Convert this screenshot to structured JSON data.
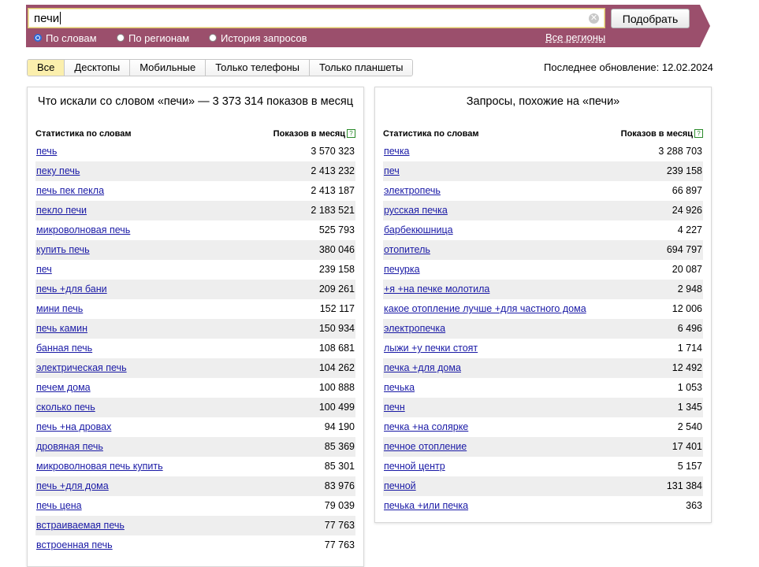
{
  "search": {
    "query": "печи",
    "submit_label": "Подобрать",
    "modes": [
      {
        "label": "По словам",
        "checked": true
      },
      {
        "label": "По регионам",
        "checked": false
      },
      {
        "label": "История запросов",
        "checked": false
      }
    ],
    "regions_link": "Все регионы"
  },
  "device_tabs": [
    {
      "label": "Все",
      "active": true
    },
    {
      "label": "Десктопы",
      "active": false
    },
    {
      "label": "Мобильные",
      "active": false
    },
    {
      "label": "Только телефоны",
      "active": false
    },
    {
      "label": "Только планшеты",
      "active": false
    }
  ],
  "last_update": "Последнее обновление: 12.02.2024",
  "left_panel": {
    "title": "Что искали со словом «печи» — 3 373 314 показов в месяц",
    "col_phrase": "Статистика по словам",
    "col_count": "Показов в месяц",
    "rows": [
      {
        "phrase": "печь",
        "count": "3 570 323"
      },
      {
        "phrase": "пеку печь",
        "count": "2 413 232"
      },
      {
        "phrase": "печь пек пекла",
        "count": "2 413 187"
      },
      {
        "phrase": "пекло печи",
        "count": "2 183 521"
      },
      {
        "phrase": "микроволновая печь",
        "count": "525 793"
      },
      {
        "phrase": "купить печь",
        "count": "380 046"
      },
      {
        "phrase": "печ",
        "count": "239 158"
      },
      {
        "phrase": "печь +для бани",
        "count": "209 261"
      },
      {
        "phrase": "мини печь",
        "count": "152 117"
      },
      {
        "phrase": "печь камин",
        "count": "150 934"
      },
      {
        "phrase": "банная печь",
        "count": "108 681"
      },
      {
        "phrase": "электрическая печь",
        "count": "104 262"
      },
      {
        "phrase": "печем дома",
        "count": "100 888"
      },
      {
        "phrase": "сколько печь",
        "count": "100 499"
      },
      {
        "phrase": "печь +на дровах",
        "count": "94 190"
      },
      {
        "phrase": "дровяная печь",
        "count": "85 369"
      },
      {
        "phrase": "микроволновая печь купить",
        "count": "85 301"
      },
      {
        "phrase": "печь +для дома",
        "count": "83 976"
      },
      {
        "phrase": "печь цена",
        "count": "79 039"
      },
      {
        "phrase": "встраиваемая печь",
        "count": "77 763"
      },
      {
        "phrase": "встроенная печь",
        "count": "77 763"
      }
    ]
  },
  "right_panel": {
    "title": "Запросы, похожие на «печи»",
    "col_phrase": "Статистика по словам",
    "col_count": "Показов в месяц",
    "rows": [
      {
        "phrase": "печка",
        "count": "3 288 703"
      },
      {
        "phrase": "печ",
        "count": "239 158"
      },
      {
        "phrase": "электропечь",
        "count": "66 897"
      },
      {
        "phrase": "русская печка",
        "count": "24 926"
      },
      {
        "phrase": "барбекюшница",
        "count": "4 227"
      },
      {
        "phrase": "отопитель",
        "count": "694 797"
      },
      {
        "phrase": "печурка",
        "count": "20 087"
      },
      {
        "phrase": "+я +на печке молотила",
        "count": "2 948"
      },
      {
        "phrase": "какое отопление лучше +для частного дома",
        "count": "12 006"
      },
      {
        "phrase": "электропечка",
        "count": "6 496"
      },
      {
        "phrase": "лыжи +у печки стоят",
        "count": "1 714"
      },
      {
        "phrase": "печка +для дома",
        "count": "12 492"
      },
      {
        "phrase": "печька",
        "count": "1 053"
      },
      {
        "phrase": "печн",
        "count": "1 345"
      },
      {
        "phrase": "печка +на солярке",
        "count": "2 540"
      },
      {
        "phrase": "печное отопление",
        "count": "17 401"
      },
      {
        "phrase": "печной центр",
        "count": "5 157"
      },
      {
        "phrase": "печной",
        "count": "131 384"
      },
      {
        "phrase": "печька +или печка",
        "count": "363"
      }
    ]
  },
  "icons": {
    "clear": "clear-icon",
    "help": "help-icon"
  }
}
